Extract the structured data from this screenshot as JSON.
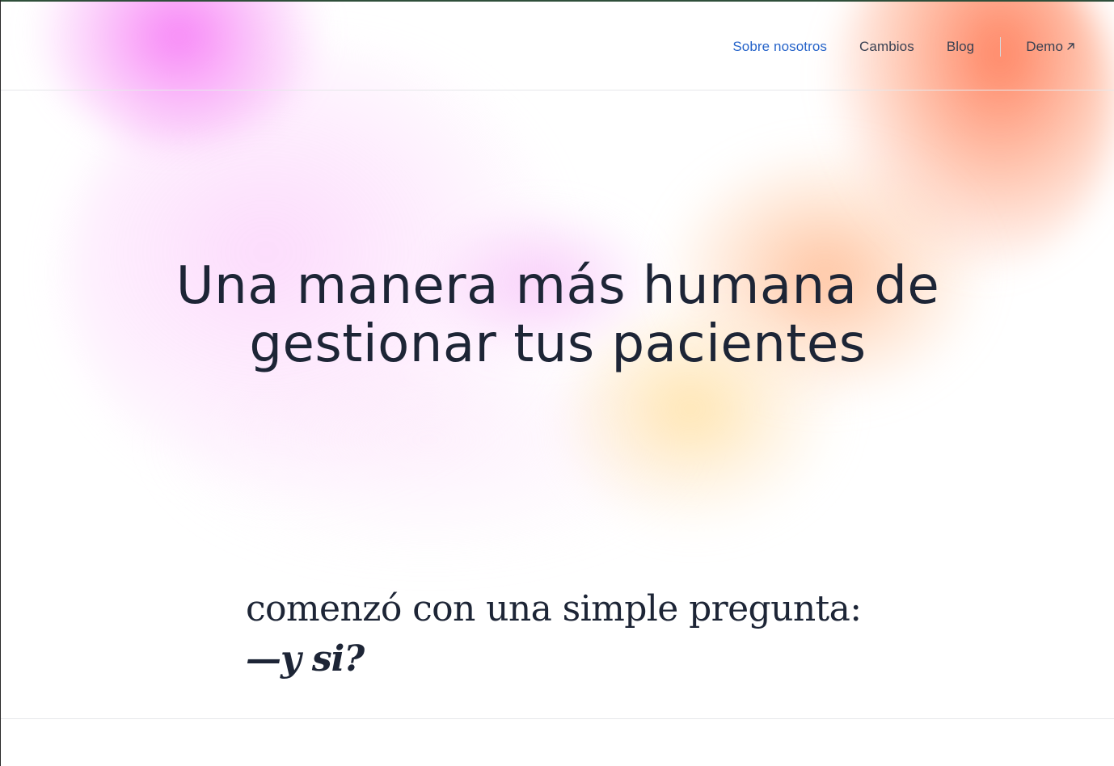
{
  "nav": {
    "items": [
      {
        "label": "Sobre nosotros",
        "active": true
      },
      {
        "label": "Cambios",
        "active": false
      },
      {
        "label": "Blog",
        "active": false
      }
    ],
    "demo_label": "Demo",
    "demo_icon": "arrow-up-right-icon",
    "active_color": "#2563c9",
    "text_color": "#3a4152"
  },
  "hero": {
    "title_line1": "Una manera más humana de",
    "title_line2": "gestionar tus pacientes",
    "text_color": "#1d2536"
  },
  "quote": {
    "line1": "comenzó con una simple pregunta:",
    "line2": "—y si?"
  },
  "colors": {
    "accent_pink": "#f66ef5",
    "accent_orange": "#ff6e46",
    "accent_yellow": "#ffdc96"
  }
}
